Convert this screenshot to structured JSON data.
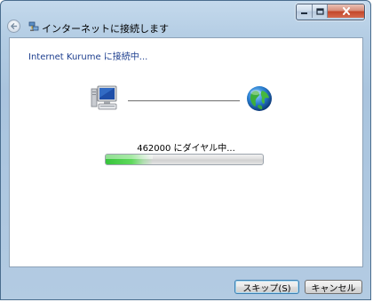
{
  "window": {
    "title": "インターネットに接続します",
    "controls": {
      "minimize_icon": "minimize-icon",
      "maximize_icon": "maximize-icon",
      "close_icon": "close-icon"
    }
  },
  "nav": {
    "back_icon": "back-arrow-icon"
  },
  "content": {
    "heading": "Internet Kurume に接続中...",
    "status": "462000 にダイヤル中...",
    "progress_fraction": 0.3,
    "left_icon": "computer-icon",
    "right_icon": "globe-icon"
  },
  "buttons": {
    "skip_label": "スキップ(S)",
    "cancel_label": "キャンセル"
  },
  "colors": {
    "heading": "#1e3f8f",
    "progress_fill": "#37c43b"
  }
}
